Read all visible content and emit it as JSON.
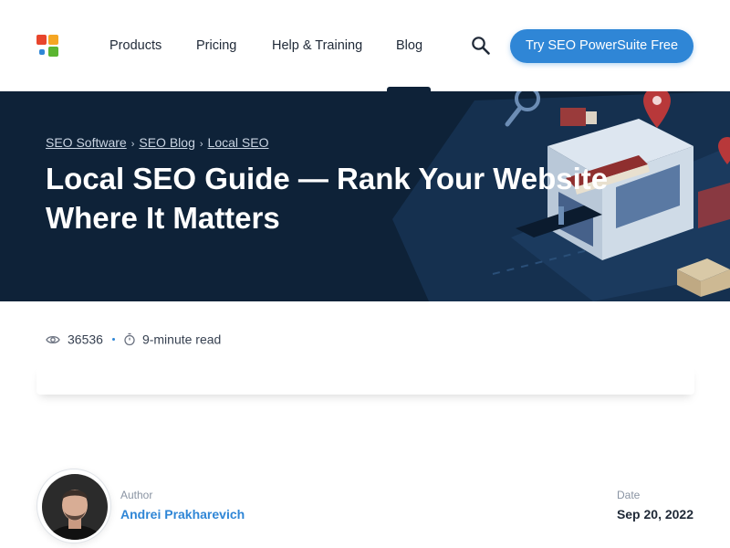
{
  "header": {
    "nav": [
      "Products",
      "Pricing",
      "Help & Training",
      "Blog"
    ],
    "cta_label": "Try SEO PowerSuite Free",
    "colors": {
      "accent": "#2f86d6",
      "hero_bg": "#0e2238"
    }
  },
  "breadcrumb": [
    "SEO Software",
    "SEO Blog",
    "Local SEO"
  ],
  "hero": {
    "title": "Local SEO Guide — Rank Your Website Where It Matters"
  },
  "meta": {
    "views": "36536",
    "read_time": "9-minute read"
  },
  "author": {
    "label": "Author",
    "name": "Andrei Prakharevich"
  },
  "date": {
    "label": "Date",
    "value": "Sep 20, 2022"
  }
}
